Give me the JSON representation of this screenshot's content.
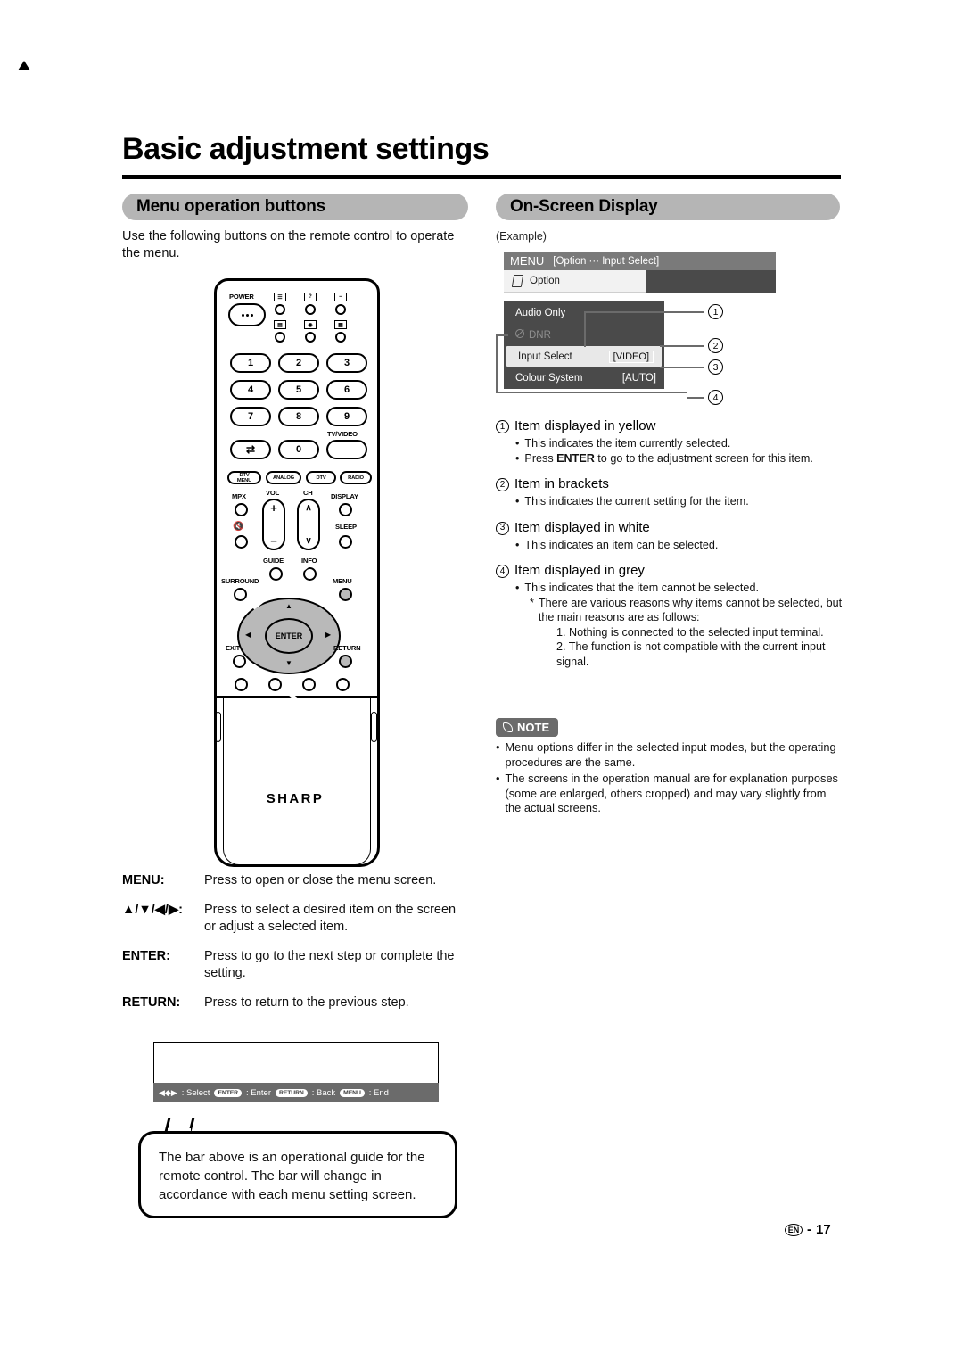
{
  "document": {
    "title": "Basic adjustment settings",
    "footer": {
      "locale": "EN",
      "separator": "-",
      "page": "17"
    }
  },
  "left_section": {
    "heading": "Menu operation buttons",
    "intro": "Use the following buttons on the remote control to operate the menu.",
    "remote": {
      "brand": "SHARP",
      "power_label": "POWER",
      "numeric_keys": [
        "1",
        "2",
        "3",
        "4",
        "5",
        "6",
        "7",
        "8",
        "9",
        "0"
      ],
      "tv_video_label": "TV/VIDEO",
      "mode_buttons": [
        "DTV MENU",
        "ANALOG",
        "DTV",
        "RADIO"
      ],
      "function_labels": {
        "mpx": "MPX",
        "vol": "VOL",
        "ch": "CH",
        "display": "DISPLAY",
        "sleep": "SLEEP",
        "guide": "GUIDE",
        "info": "INFO",
        "surround": "SURROUND",
        "menu": "MENU",
        "exit": "EXIT",
        "return": "RETURN",
        "enter": "ENTER",
        "vol_plus": "+",
        "vol_minus": "−"
      }
    },
    "key_legend": [
      {
        "key": "MENU:",
        "desc": "Press to open or close the menu screen."
      },
      {
        "key": "▲/▼/◀/▶:",
        "desc": "Press to select a desired item on the screen or adjust a selected item."
      },
      {
        "key": "ENTER:",
        "desc": "Press to go to the next step or complete the setting."
      },
      {
        "key": "RETURN:",
        "desc": "Press to return to the previous step."
      }
    ],
    "guide_bar": {
      "select_label": ": Select",
      "enter_chip": "ENTER",
      "enter_label": ": Enter",
      "return_chip": "RETURN",
      "return_label": ": Back",
      "menu_chip": "MENU",
      "menu_label": ": End"
    },
    "balloon": "The bar above is an operational guide for the remote control. The bar will change in accordance with each menu setting screen."
  },
  "right_section": {
    "heading": "On-Screen Display",
    "example_label": "(Example)",
    "osd": {
      "titlebar_menu": "MENU",
      "titlebar_path": "[Option ··· Input Select]",
      "tab_label": "Option",
      "items": [
        {
          "label": "Audio Only",
          "value": "",
          "state": "white"
        },
        {
          "label": "DNR",
          "value": "",
          "state": "grey"
        },
        {
          "label": "Input Select",
          "value": "[VIDEO]",
          "state": "selected"
        },
        {
          "label": "Colour System",
          "value": "[AUTO]",
          "state": "white"
        }
      ],
      "callouts": [
        "1",
        "2",
        "3",
        "4"
      ]
    },
    "explanations": [
      {
        "num": "1",
        "title": "Item displayed in yellow",
        "bullets": [
          "This indicates the item currently selected.",
          "Press ENTER to go to the adjustment screen for this item."
        ],
        "bold_word": "ENTER"
      },
      {
        "num": "2",
        "title": "Item in brackets",
        "bullets": [
          "This indicates the current setting for the item."
        ]
      },
      {
        "num": "3",
        "title": "Item displayed in white",
        "bullets": [
          "This indicates an item can be selected."
        ]
      },
      {
        "num": "4",
        "title": "Item displayed in grey",
        "bullets": [
          "This indicates that the item cannot be selected."
        ],
        "star_note": "There are various reasons why items cannot be selected, but the main reasons are as follows:",
        "numbered": [
          "1. Nothing is connected to the selected input terminal.",
          "2. The function is not compatible with the current input signal."
        ]
      }
    ],
    "note": {
      "badge": "NOTE",
      "bullets": [
        "Menu options differ in the selected input modes, but the operating procedures are the same.",
        "The screens in the operation manual are for explanation purposes (some are enlarged, others cropped) and may vary slightly from the actual screens."
      ]
    }
  }
}
